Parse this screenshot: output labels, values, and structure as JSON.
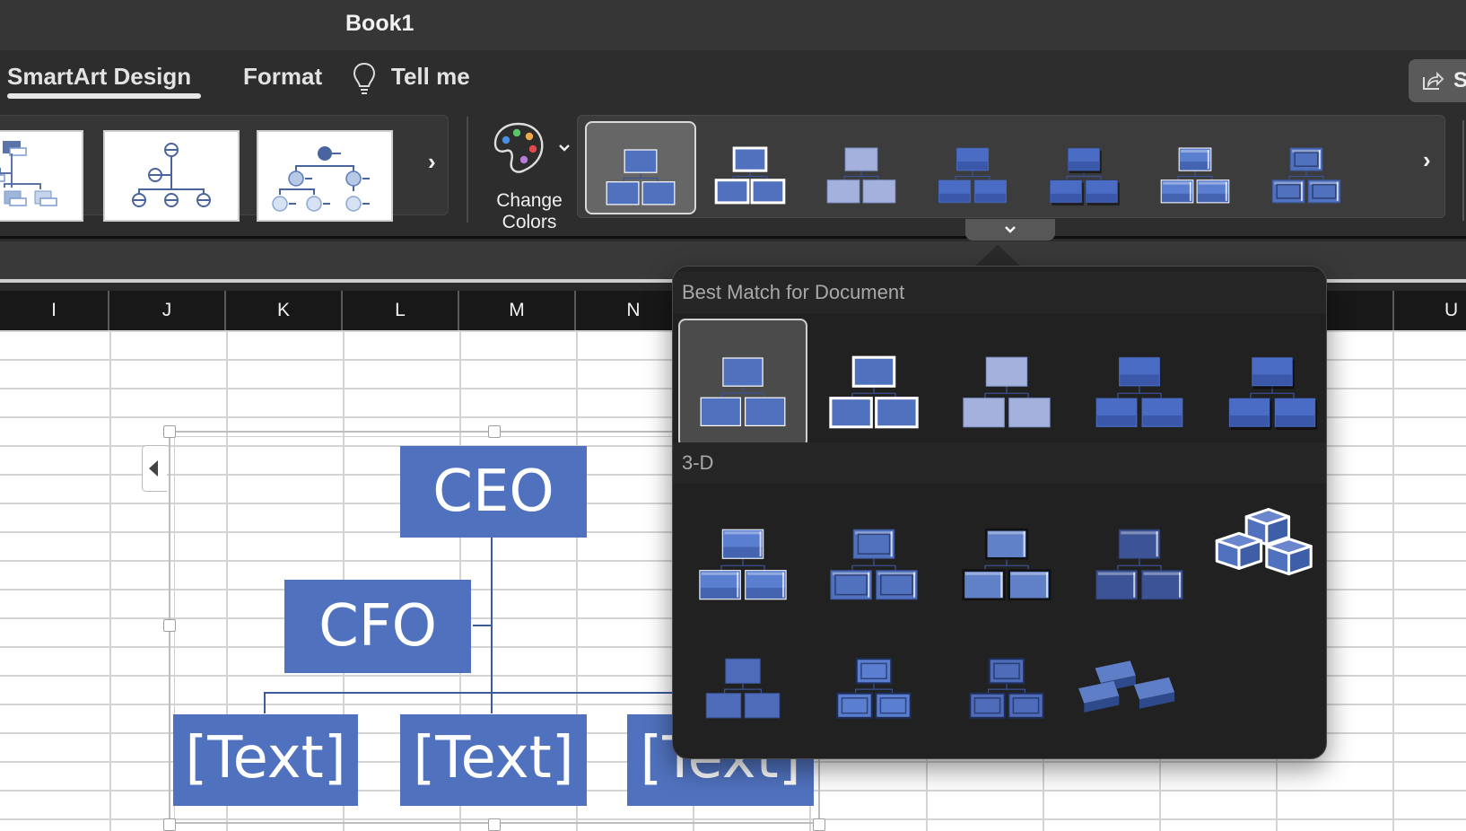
{
  "window": {
    "title": "Book1"
  },
  "ribbon_tabs": [
    {
      "label": "SmartArt Design",
      "active": true
    },
    {
      "label": "Format",
      "active": false
    },
    {
      "label": "Tell me",
      "icon": "lightbulb-icon"
    }
  ],
  "share_button": {
    "label": "S",
    "icon": "share-icon"
  },
  "layouts_gallery": {
    "items": [
      "Organization Chart (names)",
      "Hierarchy (circles)",
      "Circle Picture Hierarchy"
    ],
    "next_icon": "chevron-right-icon"
  },
  "change_colors": {
    "label_line1": "Change",
    "label_line2": "Colors",
    "icon": "palette-icon",
    "dropdown_icon": "chevron-down-icon"
  },
  "styles_gallery": {
    "items": [
      "Simple Fill",
      "White Outline",
      "Subtle Effect",
      "Moderate Effect",
      "Intense Effect",
      "Polished",
      "Inset"
    ],
    "selected_index": 0,
    "next_icon": "chevron-right-icon",
    "expand_icon": "chevron-down-icon"
  },
  "columns": [
    "I",
    "J",
    "K",
    "L",
    "M",
    "N",
    "U"
  ],
  "smartart": {
    "nodes": {
      "ceo": "CEO",
      "cfo": "CFO",
      "child1": "[Text]",
      "child2": "[Text]",
      "child3": "[Text]"
    },
    "node_color": "#5072be"
  },
  "styles_popup": {
    "sections": [
      {
        "title": "Best Match for Document",
        "items": [
          "Simple Fill",
          "White Outline",
          "Subtle Effect",
          "Moderate Effect",
          "Intense Effect"
        ],
        "selected_index": 0
      },
      {
        "title": "3-D",
        "items": [
          "Polished",
          "Inset",
          "Cartoon",
          "Powder",
          "Brick Scene",
          "Flat Scene",
          "Metallic Scene",
          "Sunset Scene",
          "Bird's Eye Scene"
        ]
      }
    ]
  }
}
